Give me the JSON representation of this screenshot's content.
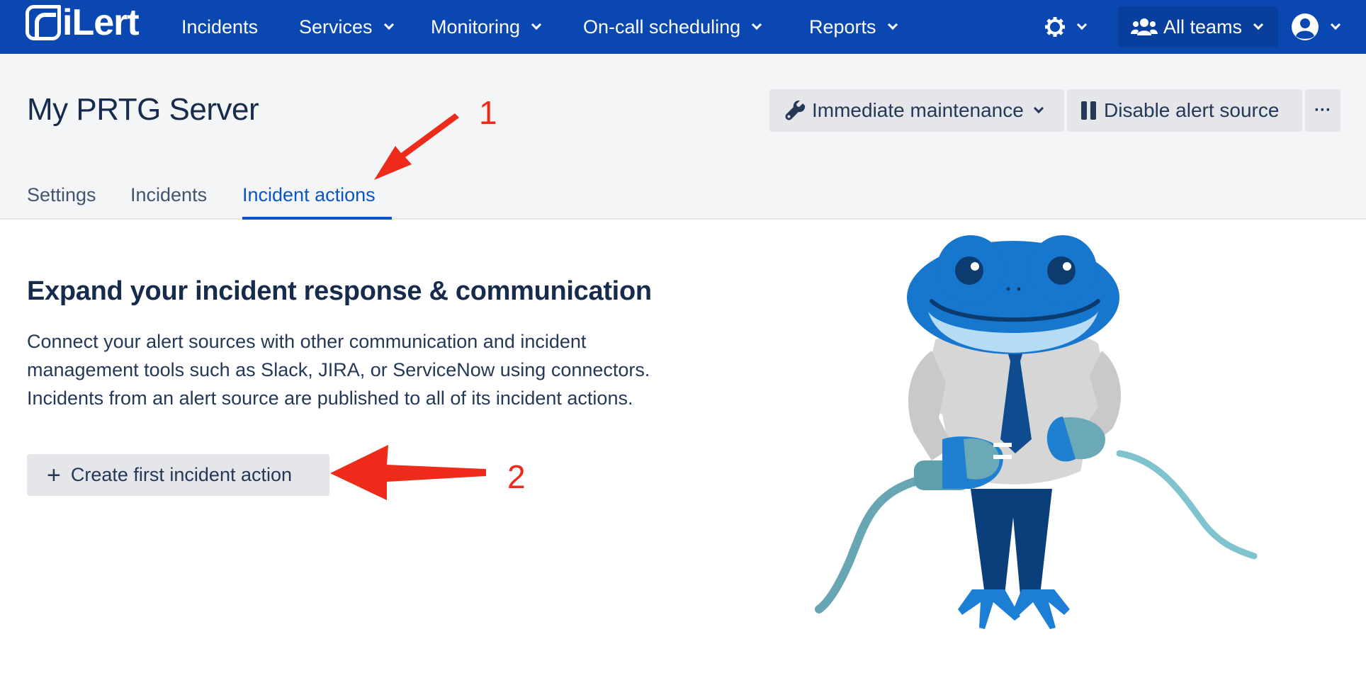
{
  "nav": {
    "logo": "iLert",
    "items": [
      {
        "label": "Incidents"
      },
      {
        "label": "Services"
      },
      {
        "label": "Monitoring"
      },
      {
        "label": "On-call scheduling"
      },
      {
        "label": "Reports"
      }
    ],
    "teams_label": "All teams",
    "icons": [
      "gear-icon",
      "users-icon",
      "user-avatar-icon",
      "chevron-down-icon"
    ]
  },
  "header": {
    "title": "My PRTG Server",
    "maintenance_label": "Immediate maintenance",
    "disable_label": "Disable alert source",
    "more_label": "···",
    "tabs": [
      {
        "label": "Settings",
        "active": false
      },
      {
        "label": "Incidents",
        "active": false
      },
      {
        "label": "Incident actions",
        "active": true
      }
    ]
  },
  "content": {
    "title": "Expand your incident response & communication",
    "description": "Connect your alert sources with other communication and incident management tools such as Slack, JIRA, or ServiceNow using connectors. Incidents from an alert source are published to all of its incident actions.",
    "create_label": "Create first incident action"
  },
  "annotations": {
    "first": "1",
    "second": "2"
  },
  "colors": {
    "nav_bg": "#0a47b0",
    "accent": "#0a55c6",
    "annotation": "#ee2a1b"
  }
}
